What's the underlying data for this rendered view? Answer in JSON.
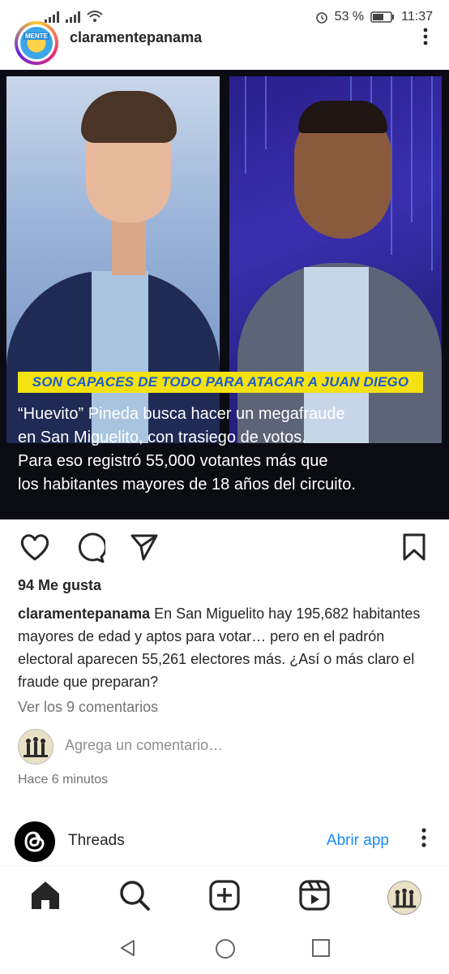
{
  "status_bar": {
    "battery": "53 %",
    "time": "11:37"
  },
  "post": {
    "username": "claramentepanama",
    "avatar_text": "MENTE",
    "image": {
      "highlight": "SON CAPACES DE TODO PARA ATACAR A JUAN DIEGO",
      "lines": [
        "“Huevito” Pineda busca hacer un megafraude",
        "en San Miguelito, con trasiego de votos.",
        "Para eso registró 55,000 votantes más que",
        "los habitantes mayores de 18 años del circuito."
      ]
    },
    "likes": "94 Me gusta",
    "caption_user": "claramentepanama",
    "caption_text": " En San Miguelito hay 195,682 habitantes mayores de edad y aptos para votar… pero en el padrón electoral aparecen 55,261 electores más. ¿Así o más claro el fraude que preparan?",
    "view_comments": "Ver los 9 comentarios",
    "comment_placeholder": "Agrega un comentario…",
    "time_ago": "Hace 6 minutos"
  },
  "threads_banner": {
    "label": "Threads",
    "open_app": "Abrir app"
  },
  "icons": {
    "like": "heart-icon",
    "comment": "comment-icon",
    "share": "send-icon",
    "save": "bookmark-icon"
  },
  "colors": {
    "highlight_bg": "#f3e20f",
    "highlight_text": "#1c5bd6",
    "link": "#1a8af5"
  }
}
